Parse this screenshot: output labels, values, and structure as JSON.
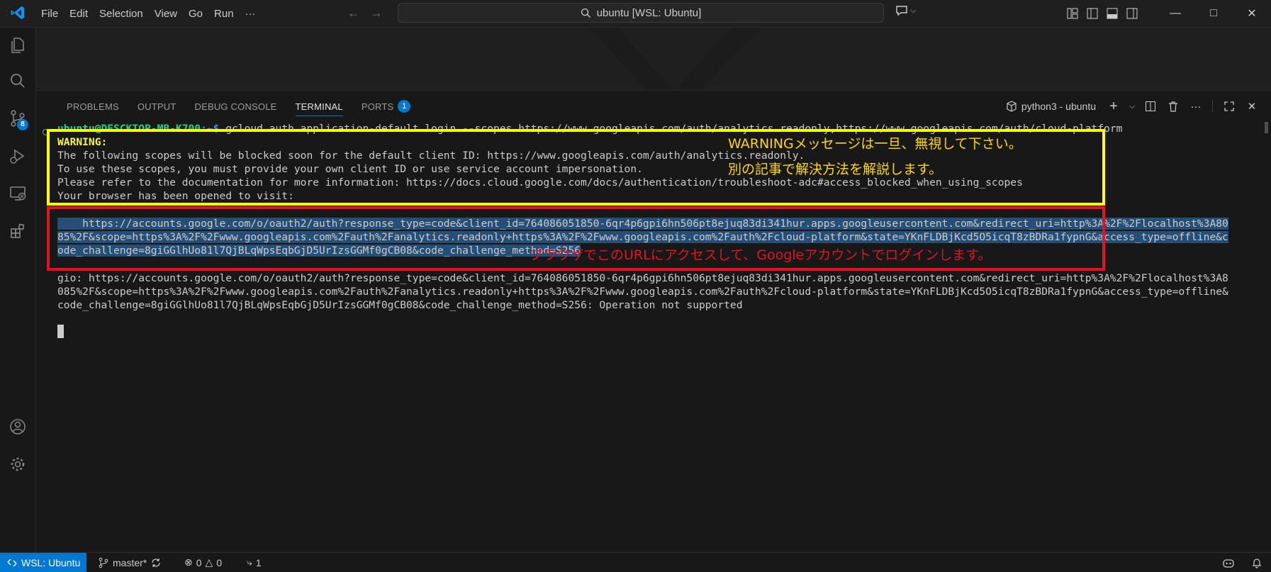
{
  "titlebar": {
    "menu": [
      "File",
      "Edit",
      "Selection",
      "View",
      "Go",
      "Run",
      "···"
    ],
    "search": "ubuntu [WSL: Ubuntu]"
  },
  "activitybar": {
    "source_control_badge": "8"
  },
  "panel": {
    "tabs": [
      "PROBLEMS",
      "OUTPUT",
      "DEBUG CONSOLE",
      "TERMINAL",
      "PORTS"
    ],
    "ports_badge": "1",
    "terminal_name": "python3 - ubuntu"
  },
  "terminal": {
    "prompt_user": "ubuntu@DESCKTOP-MB-K700",
    "prompt_path": ":~$",
    "command": " gcloud auth application-default login --scopes https://www.googleapis.com/auth/analytics.readonly,https://www.googleapis.com/auth/cloud-platform",
    "warning_label": "WARNING:",
    "warning_lines": [
      "The following scopes will be blocked soon for the default client ID: https://www.googleapis.com/auth/analytics.readonly.",
      "To use these scopes, you must provide your own client ID or use service account impersonation.",
      "Please refer to the documentation for more information: https://docs.cloud.google.com/docs/authentication/troubleshoot-adc#access_blocked_when_using_scopes",
      "Your browser has been opened to visit:"
    ],
    "url_lines": [
      "https://accounts.google.com/o/oauth2/auth?response_type=code&client_id=764086051850-6qr4p6gpi6hn506pt8ejuq83di341hur.apps.googleusercontent.com&redirect_uri=http%3A%2F%2Flocalhost%3A80",
      "85%2F&scope=https%3A%2F%2Fwww.googleapis.com%2Fauth%2Fanalytics.readonly+https%3A%2F%2Fwww.googleapis.com%2Fauth%2Fcloud-platform&state=YKnFLDBjKcd5O5icqT8zBDRa1fypnG&access_type=offline&c",
      "ode_challenge=8giGGlhUo81l7QjBLqWpsEqbGjD5UrIzsGGMf0gCB08&code_challenge_method=S256"
    ],
    "gio_lines": [
      "gio: https://accounts.google.com/o/oauth2/auth?response_type=code&client_id=764086051850-6qr4p6gpi6hn506pt8ejuq83di341hur.apps.googleusercontent.com&redirect_uri=http%3A%2F%2Flocalhost%3A8",
      "085%2F&scope=https%3A%2F%2Fwww.googleapis.com%2Fauth%2Fanalytics.readonly+https%3A%2F%2Fwww.googleapis.com%2Fauth%2Fcloud-platform&state=YKnFLDBjKcd5O5icqT8zBDRa1fypnG&access_type=offline&",
      "code_challenge=8giGGlhUo81l7QjBLqWpsEqbGjD5UrIzsGGMf0gCB08&code_challenge_method=S256: Operation not supported"
    ]
  },
  "annotations": {
    "yellow_line1": "WARNINGメッセージは一旦、無視して下さい。",
    "yellow_line2": "別の記事で解決方法を解説します。",
    "red_line": "ブラウザでこのURLにアクセスして、Googleアカウントでログインします。"
  },
  "statusbar": {
    "remote": "WSL: Ubuntu",
    "branch": "master*",
    "errors": "0",
    "warnings": "0",
    "ports": "1"
  }
}
